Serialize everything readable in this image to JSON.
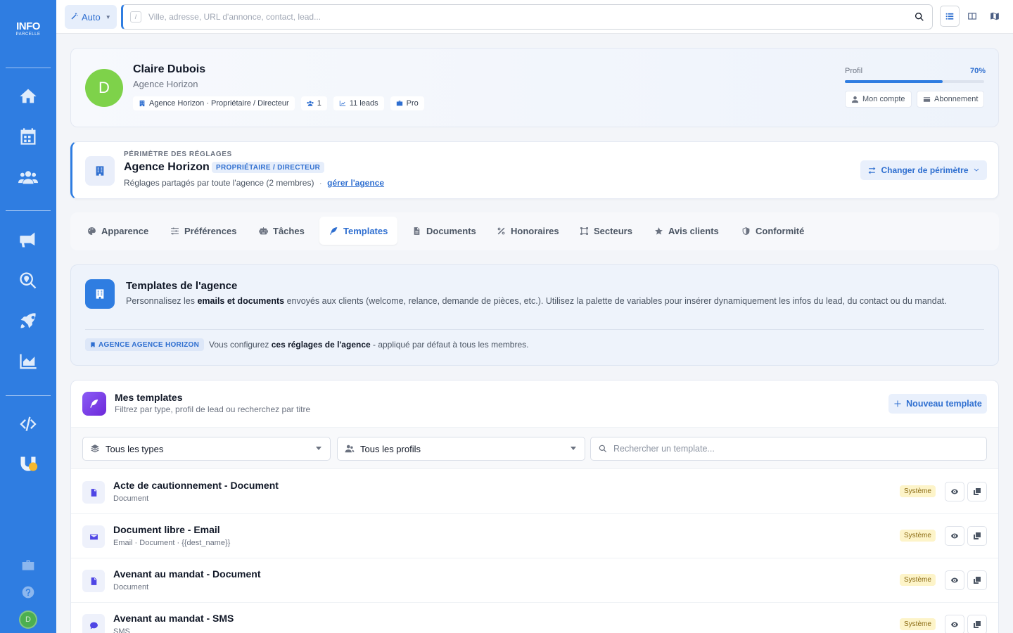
{
  "app": {
    "logo_top": "INFO",
    "logo_bottom": "PARCELLE"
  },
  "topbar": {
    "mode_label": "Auto",
    "search_shortcut": "/",
    "search_placeholder": "Ville, adresse, URL d'annonce, contact, lead..."
  },
  "profile": {
    "initial": "D",
    "name": "Claire Dubois",
    "agency": "Agence Horizon",
    "chips": [
      {
        "label": "Agence Horizon · Propriétaire / Directeur",
        "icon": "building-icon"
      },
      {
        "label": "1",
        "icon": "users-icon"
      },
      {
        "label": "11 leads",
        "icon": "chart-line-icon"
      },
      {
        "label": "Pro",
        "icon": "briefcase-icon"
      }
    ],
    "progress_label": "Profil",
    "progress_text": "70%",
    "progress_value": 0.7,
    "account_label": "Mon compte",
    "subscription_label": "Abonnement"
  },
  "scope": {
    "eyebrow": "PÉRIMÈTRE DES RÉGLAGES",
    "title": "Agence Horizon",
    "role": "PROPRIÉTAIRE / DIRECTEUR",
    "desc": "Réglages partagés par toute l'agence (2 membres)",
    "separator": "·",
    "link": "gérer l'agence",
    "change_label": "Changer de périmètre"
  },
  "tabs": [
    {
      "label": "Apparence",
      "icon": "palette-icon",
      "active": false
    },
    {
      "label": "Préférences",
      "icon": "sliders-icon",
      "active": false
    },
    {
      "label": "Tâches",
      "icon": "robot-icon",
      "active": false
    },
    {
      "label": "Templates",
      "icon": "feather-icon",
      "active": true
    },
    {
      "label": "Documents",
      "icon": "file-icon",
      "active": false
    },
    {
      "label": "Honoraires",
      "icon": "percent-icon",
      "active": false
    },
    {
      "label": "Secteurs",
      "icon": "draw-polygon-icon",
      "active": false
    },
    {
      "label": "Avis clients",
      "icon": "star-icon",
      "active": false
    },
    {
      "label": "Conformité",
      "icon": "shield-icon",
      "active": false
    }
  ],
  "intro": {
    "title": "Templates de l'agence",
    "desc_pre": "Personnalisez les ",
    "desc_bold": "emails et documents",
    "desc_post": " envoyés aux clients (welcome, relance, demande de pièces, etc.). Utilisez la palette de variables pour insérer dynamiquement les infos du lead, du contact ou du mandat.",
    "badge": "AGENCE AGENCE HORIZON",
    "note_pre": "Vous configurez ",
    "note_bold": "ces réglages de l'agence",
    "note_post": " - appliqué par défaut à tous les membres."
  },
  "templates": {
    "title": "Mes templates",
    "subtitle": "Filtrez par type, profil de lead ou recherchez par titre",
    "new_label": "Nouveau template",
    "filter_type": "Tous les types",
    "filter_profile": "Tous les profils",
    "search_placeholder": "Rechercher un template...",
    "rows": [
      {
        "title": "Acte de cautionnement - Document",
        "sub": "Document",
        "badge": "Système",
        "icon": "file-pdf-icon"
      },
      {
        "title": "Document libre - Email",
        "sub": "Email · Document · {{dest_name}}",
        "badge": "Système",
        "icon": "envelope-icon"
      },
      {
        "title": "Avenant au mandat - Document",
        "sub": "Document",
        "badge": "Système",
        "icon": "file-pdf-icon"
      },
      {
        "title": "Avenant au mandat - SMS",
        "sub": "SMS",
        "badge": "Système",
        "icon": "sms-icon"
      }
    ]
  }
}
